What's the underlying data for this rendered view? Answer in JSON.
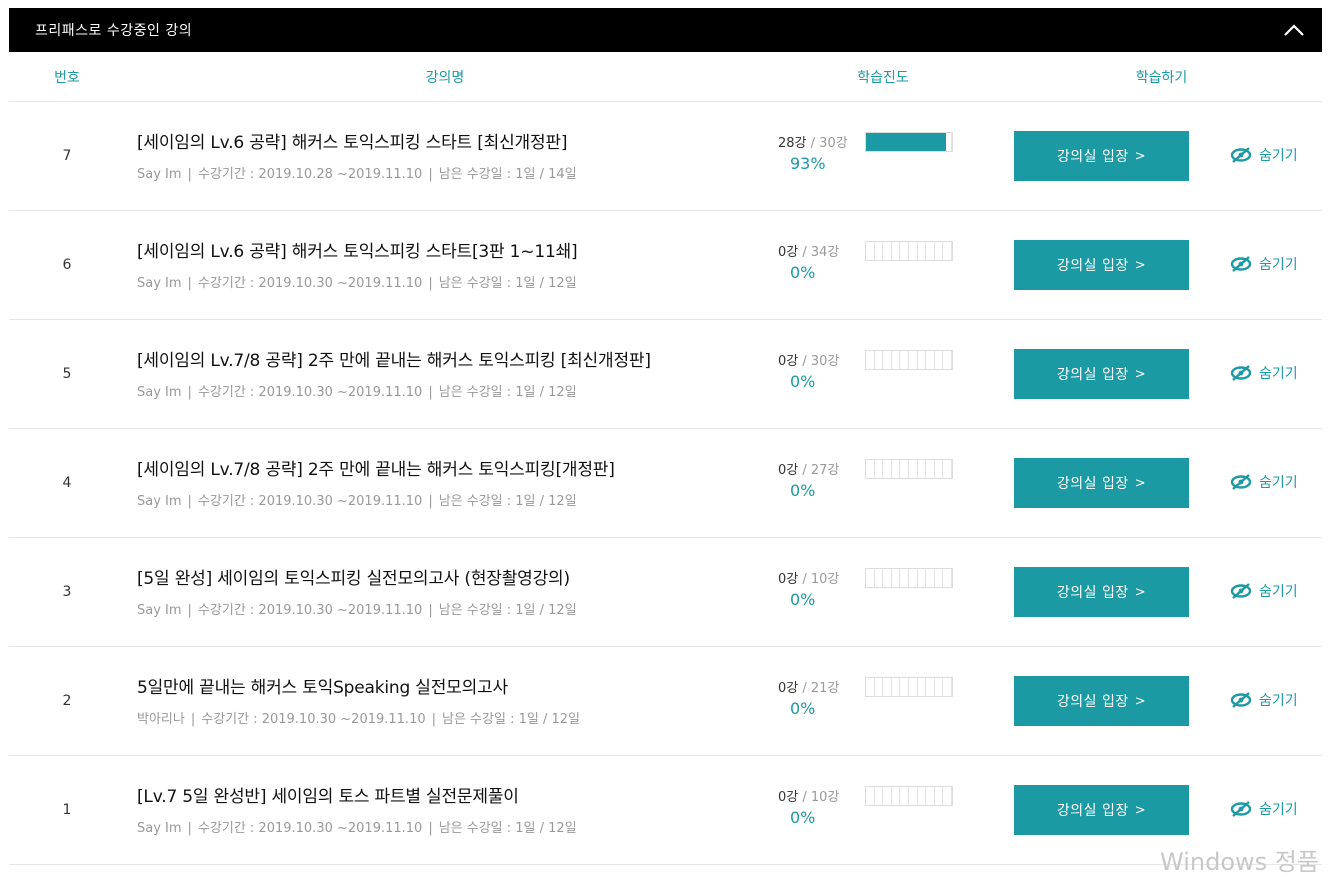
{
  "header": {
    "title": "프리패스로 수강중인 강의"
  },
  "columns": {
    "no": "번호",
    "name": "강의명",
    "progress": "학습진도",
    "action": "학습하기"
  },
  "colors": {
    "accent": "#1b9aa3",
    "header_bg": "#000000"
  },
  "courses": [
    {
      "no": "7",
      "title": "[세이임의 Lv.6 공략] 해커스 토익스피킹 스타트 [최신개정판]",
      "instructor": "Say Im",
      "period": "수강기간 : 2019.10.28 ~2019.11.10",
      "remain": "남은 수강일 : 1일 / 14일",
      "done": "28강",
      "total": "/ 30강",
      "percent": "93%",
      "progress": 0.93,
      "button": "강의실 입장",
      "hide": "숨기기"
    },
    {
      "no": "6",
      "title": "[세이임의 Lv.6 공략] 해커스 토익스피킹 스타트[3판 1~11쇄]",
      "instructor": "Say Im",
      "period": "수강기간 : 2019.10.30 ~2019.11.10",
      "remain": "남은 수강일 : 1일 / 12일",
      "done": "0강",
      "total": "/ 34강",
      "percent": "0%",
      "progress": 0,
      "button": "강의실 입장",
      "hide": "숨기기"
    },
    {
      "no": "5",
      "title": "[세이임의 Lv.7/8 공략] 2주 만에 끝내는 해커스 토익스피킹 [최신개정판]",
      "instructor": "Say Im",
      "period": "수강기간 : 2019.10.30 ~2019.11.10",
      "remain": "남은 수강일 : 1일 / 12일",
      "done": "0강",
      "total": "/ 30강",
      "percent": "0%",
      "progress": 0,
      "button": "강의실 입장",
      "hide": "숨기기"
    },
    {
      "no": "4",
      "title": "[세이임의 Lv.7/8 공략] 2주 만에 끝내는 해커스 토익스피킹[개정판]",
      "instructor": "Say Im",
      "period": "수강기간 : 2019.10.30 ~2019.11.10",
      "remain": "남은 수강일 : 1일 / 12일",
      "done": "0강",
      "total": "/ 27강",
      "percent": "0%",
      "progress": 0,
      "button": "강의실 입장",
      "hide": "숨기기"
    },
    {
      "no": "3",
      "title": "[5일 완성] 세이임의 토익스피킹 실전모의고사 (현장촬영강의)",
      "instructor": "Say Im",
      "period": "수강기간 : 2019.10.30 ~2019.11.10",
      "remain": "남은 수강일 : 1일 / 12일",
      "done": "0강",
      "total": "/ 10강",
      "percent": "0%",
      "progress": 0,
      "button": "강의실 입장",
      "hide": "숨기기"
    },
    {
      "no": "2",
      "title": "5일만에 끝내는 해커스 토익Speaking 실전모의고사",
      "instructor": "박아리나",
      "period": "수강기간 : 2019.10.30 ~2019.11.10",
      "remain": "남은 수강일 : 1일 / 12일",
      "done": "0강",
      "total": "/ 21강",
      "percent": "0%",
      "progress": 0,
      "button": "강의실 입장",
      "hide": "숨기기"
    },
    {
      "no": "1",
      "title": "[Lv.7 5일 완성반] 세이임의 토스 파트별 실전문제풀이",
      "instructor": "Say Im",
      "period": "수강기간 : 2019.10.30 ~2019.11.10",
      "remain": "남은 수강일 : 1일 / 12일",
      "done": "0강",
      "total": "/ 10강",
      "percent": "0%",
      "progress": 0,
      "button": "강의실 입장",
      "hide": "숨기기"
    }
  ],
  "watermark": "Windows 정품"
}
